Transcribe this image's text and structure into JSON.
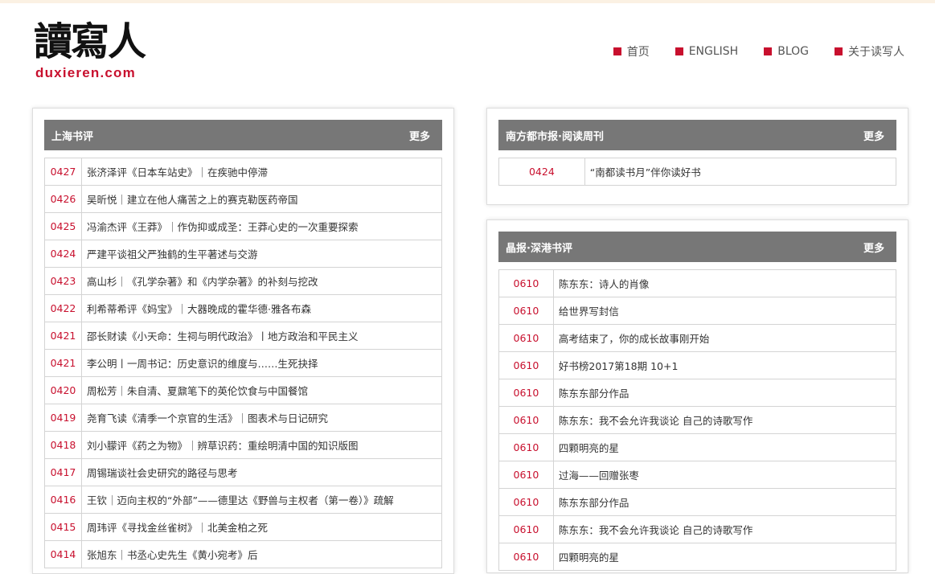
{
  "header": {
    "logo_cn": "讀寫人",
    "logo_en": "duxieren.com",
    "nav": [
      {
        "label": "首页"
      },
      {
        "label": "ENGLISH"
      },
      {
        "label": "BLOG"
      },
      {
        "label": "关于读写人"
      }
    ]
  },
  "panels": {
    "shanghai": {
      "title": "上海书评",
      "more": "更多",
      "rows": [
        {
          "date": "0427",
          "title": "张济泽评《日本车站史》｜在疾驰中停滞"
        },
        {
          "date": "0426",
          "title": "吴昕悦｜建立在他人痛苦之上的赛克勒医药帝国"
        },
        {
          "date": "0425",
          "title": "冯渝杰评《王莽》｜作伪抑或成圣：王莽心史的一次重要探索"
        },
        {
          "date": "0424",
          "title": "严建平谈祖父严独鹤的生平著述与交游"
        },
        {
          "date": "0423",
          "title": "高山杉｜《孔学杂著》和《内学杂著》的补刻与挖改"
        },
        {
          "date": "0422",
          "title": "利希蒂希评《妈宝》｜大器晚成的霍华德·雅各布森"
        },
        {
          "date": "0421",
          "title": "邵长财读《小天命：生祠与明代政治》丨地方政治和平民主义"
        },
        {
          "date": "0421",
          "title": "李公明丨一周书记：历史意识的维度与……生死抉择"
        },
        {
          "date": "0420",
          "title": "周松芳｜朱自清、夏鼐笔下的英伦饮食与中国餐馆"
        },
        {
          "date": "0419",
          "title": "尧育飞读《清季一个京官的生活》｜图表术与日记研究"
        },
        {
          "date": "0418",
          "title": "刘小朦评《药之为物》｜辨草识药：重绘明清中国的知识版图"
        },
        {
          "date": "0417",
          "title": "周锡瑞谈社会史研究的路径与思考"
        },
        {
          "date": "0416",
          "title": "王钦｜迈向主权的“外部”——德里达《野兽与主权者（第一卷）》疏解"
        },
        {
          "date": "0415",
          "title": "周玮评《寻找金丝雀树》｜北美金柏之死"
        },
        {
          "date": "0414",
          "title": "张旭东｜书丞心史先生《黄小宛考》后"
        }
      ]
    },
    "nandu": {
      "title": "南方都市报·阅读周刊",
      "more": "更多",
      "rows": [
        {
          "date": "0424",
          "title": "“南都读书月”伴你读好书"
        }
      ]
    },
    "jingbao": {
      "title": "晶报·深港书评",
      "more": "更多",
      "rows": [
        {
          "date": "0610",
          "title": "陈东东：诗人的肖像"
        },
        {
          "date": "0610",
          "title": "给世界写封信"
        },
        {
          "date": "0610",
          "title": "高考结束了，你的成长故事刚开始"
        },
        {
          "date": "0610",
          "title": "好书榜2017第18期 10+1"
        },
        {
          "date": "0610",
          "title": "陈东东部分作品"
        },
        {
          "date": "0610",
          "title": "陈东东：我不会允许我谈论 自己的诗歌写作"
        },
        {
          "date": "0610",
          "title": "四颗明亮的星"
        },
        {
          "date": "0610",
          "title": "过海——回赠张枣"
        },
        {
          "date": "0610",
          "title": "陈东东部分作品"
        },
        {
          "date": "0610",
          "title": "陈东东：我不会允许我谈论 自己的诗歌写作"
        },
        {
          "date": "0610",
          "title": "四颗明亮的星"
        }
      ]
    }
  }
}
